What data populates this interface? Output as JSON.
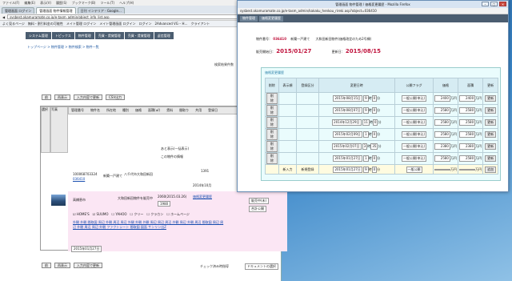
{
  "back_window": {
    "menubar": [
      "ファイル(F)",
      "編集(E)",
      "表示(V)",
      "履歴(S)",
      "ブックマーク(B)",
      "ツール(T)",
      "ヘルプ(H)"
    ],
    "tabs": [
      "管理画面 ログイン",
      "管理画面 物件情報管理",
      "日刊 インテリア - Google…"
    ],
    "url": "sysbest.okamuramate.co.jp/e-tasm_admin/object_info_list.asp",
    "bookmarks": [
      "よく見るページ",
      "無料・割引料金の可能性",
      "メイト管理 ログイン",
      "メイト管理画面 ログイン",
      "ログイン",
      "2Advanced VG – H…",
      "クライアント"
    ],
    "nav": [
      "システム管理",
      "トピックス",
      "物件管理",
      "売買・賃貸管理",
      "売買・賃貸管理",
      "返信管理"
    ],
    "breadcrumb": "トップページ > 物件管理 > 物件検索 > 物件一覧",
    "search_label": "検索結果件数",
    "toolbar_buttons": [
      "前",
      "再表示",
      "入力内容で更新",
      "CSV出力"
    ],
    "header_cells": [
      "選択",
      "写真",
      "管理番号",
      "物件名",
      "所在地",
      "種別",
      "価格",
      "面積(㎡)",
      "賃料",
      "間取り",
      "共用",
      "登録日"
    ],
    "row_note": "あと表示(一括表示)",
    "row_check": "この物件の情報",
    "row1": {
      "id": "100068703324",
      "code": "036410",
      "type": "新築一戸建て",
      "addr": "八千代市大和田新田",
      "price": "1391",
      "date": "2014年10月"
    },
    "row2": {
      "name": "高橋恵市",
      "desc": "大和田新田物件を販売中",
      "date_range": "2060(2015.03.26)",
      "link": "価格変更履歴",
      "price": "1980",
      "select1": "販売中(未)",
      "select2": "合計公開"
    },
    "checks": [
      "HOME'S",
      "SUUMO",
      "YAHOO",
      "クリー",
      "クラカン",
      "ホームページ"
    ],
    "footer_date": "2015年01月27日",
    "footer_btns": [
      "前",
      "再表示",
      "入力内容で更新"
    ],
    "footer_note": "チェック済み時指導",
    "footer_select": "ドキュメントの選択"
  },
  "front_window": {
    "title": "管理画面 物件管理 / 価格変更履歴 - Mozilla Firefox",
    "url": "sysbest.okamuramate.co.jp/e-tasm_admin/kakaku_henkou_rireki.asp?object=036410",
    "crumbs": [
      "物件管理",
      "価格変更履歴"
    ],
    "object_label": "物件番号：",
    "object_no": "036410",
    "object_type": "新築一戸建て",
    "object_addr": "大和田新田物件(価格改定のため2号棟)",
    "sale_label": "販売開始日：",
    "sale_date": "2015/01/27",
    "update_label": "更新日：",
    "update_date": "2015/08/15",
    "section_title": "価格変更履歴",
    "columns": [
      "削除",
      "表示順",
      "登録区分",
      "変更日時",
      "公開フラグ",
      "価格",
      "面積",
      "更新"
    ],
    "rows": [
      {
        "del": "削除",
        "order": "",
        "kbn": "",
        "date": "2015年08月15日",
        "h": "9",
        "m": "0",
        "flag": "一般公開(申込)",
        "price": "2400",
        "area": "2400",
        "upd": "更新"
      },
      {
        "del": "削除",
        "order": "",
        "kbn": "",
        "date": "2015年08月07日",
        "h": "9",
        "m": "0",
        "flag": "一般公開(申込)",
        "price": "2580",
        "area": "2580",
        "upd": "更新"
      },
      {
        "del": "削除",
        "order": "",
        "kbn": "",
        "date": "2014年12月29日",
        "h": "11",
        "m": "0",
        "flag": "一般公開(申込)",
        "price": "2580",
        "area": "2580",
        "upd": "更新"
      },
      {
        "del": "削除",
        "order": "",
        "kbn": "",
        "date": "2015年02月09日",
        "h": "1",
        "m": "0",
        "flag": "一般公開(申込)",
        "price": "2580",
        "area": "2580",
        "upd": "更新"
      },
      {
        "del": "削除",
        "order": "",
        "kbn": "",
        "date": "2015年02月07日",
        "h": "3",
        "m": "35",
        "flag": "一般公開(申込)",
        "price": "2380",
        "area": "2380",
        "upd": "更新"
      },
      {
        "del": "削除",
        "order": "",
        "kbn": "",
        "date": "2015年01月27日",
        "h": "1",
        "m": "0",
        "flag": "一般公開(申込)",
        "price": "2580",
        "area": "2580",
        "upd": "更新"
      }
    ],
    "new_row": {
      "order": "新入力",
      "kbn": "新規登録",
      "date": "2015年01月27日",
      "h": "9",
      "m": "0",
      "flag": "一般公開",
      "upd": "追加"
    },
    "unit": "万円",
    "hour_unit": "時",
    "min_unit": "分"
  },
  "colors": {
    "accent": "#c0123c",
    "nav": "#4b5d70",
    "table_bg": "#eafcfd"
  }
}
